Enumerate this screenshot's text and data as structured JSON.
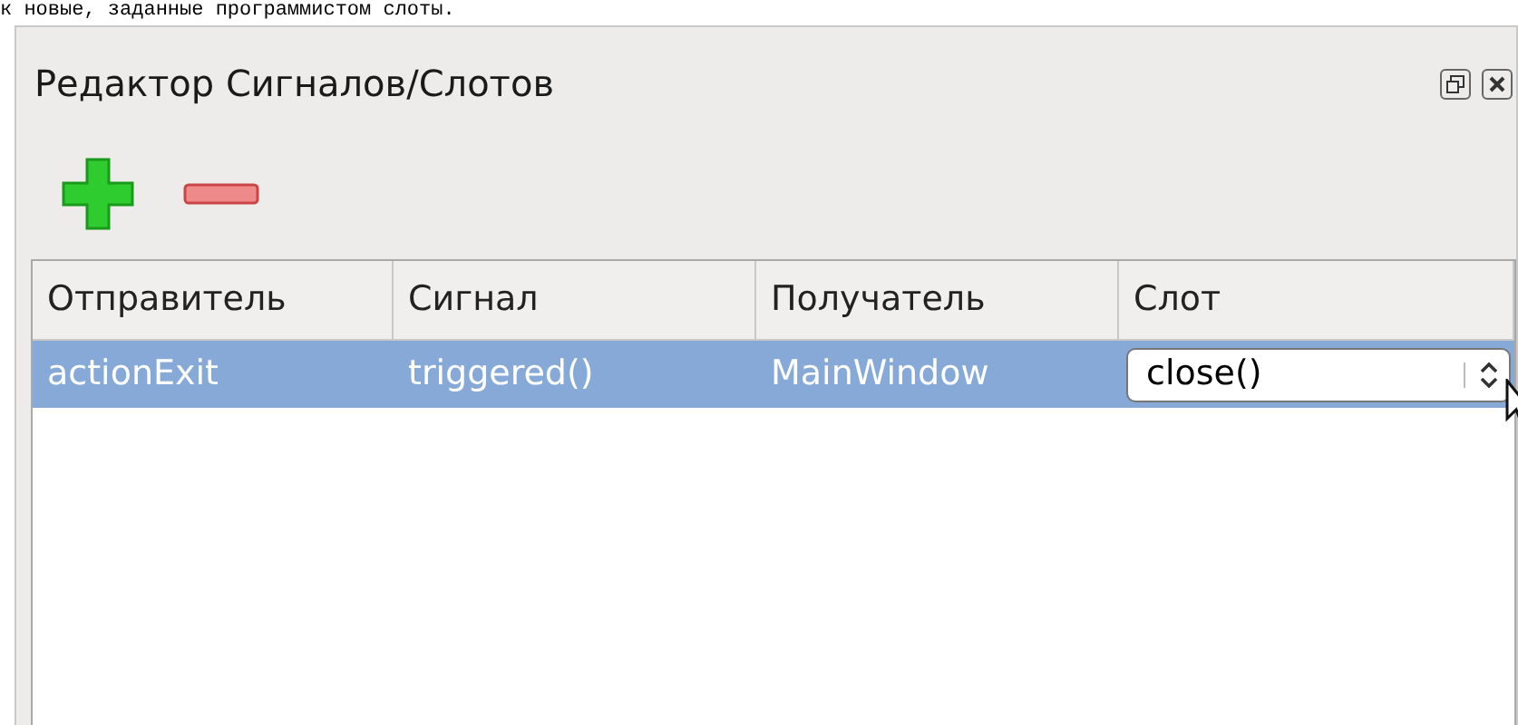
{
  "caption": "к новые, заданные программистом слоты.",
  "panel": {
    "title": "Редактор Сигналов/Слотов"
  },
  "table": {
    "columns": [
      "Отправитель",
      "Сигнал",
      "Получатель",
      "Слот"
    ],
    "rows": [
      {
        "selected": true,
        "cells": [
          "actionExit",
          "triggered()",
          "MainWindow",
          "close()"
        ]
      }
    ]
  }
}
